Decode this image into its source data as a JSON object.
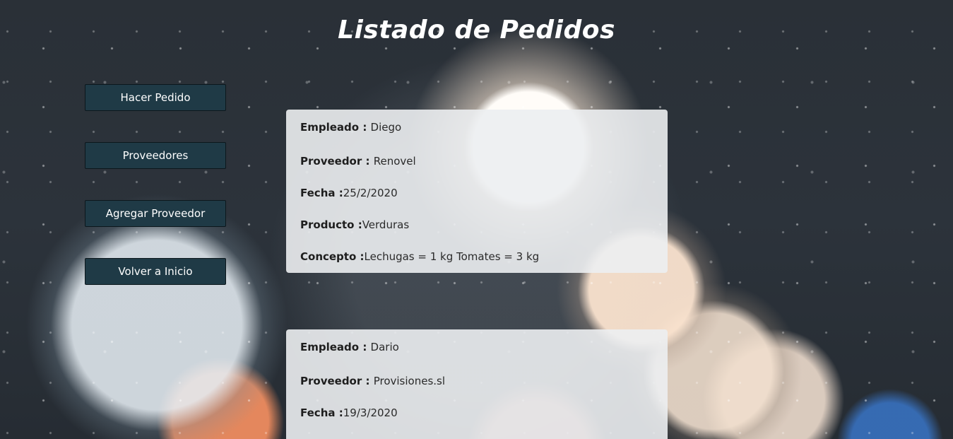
{
  "page": {
    "title": "Listado de Pedidos"
  },
  "nav": {
    "make_order": "Hacer Pedido",
    "suppliers": "Proveedores",
    "add_supplier": "Agregar Proveedor",
    "back_home": "Volver a Inicio"
  },
  "labels": {
    "employee": "Empleado : ",
    "supplier": "Proveedor : ",
    "date": "Fecha :",
    "product": "Producto :",
    "concept": "Concepto :"
  },
  "orders": [
    {
      "employee": "Diego",
      "supplier": "Renovel",
      "date": "25/2/2020",
      "product": "Verduras",
      "concept": "Lechugas = 1 kg Tomates = 3 kg"
    },
    {
      "employee": "Dario",
      "supplier": "Provisiones.sl",
      "date": "19/3/2020"
    }
  ],
  "colors": {
    "button_bg": "#1f3a46",
    "card_bg": "#eceef1",
    "title": "#ffffff"
  }
}
